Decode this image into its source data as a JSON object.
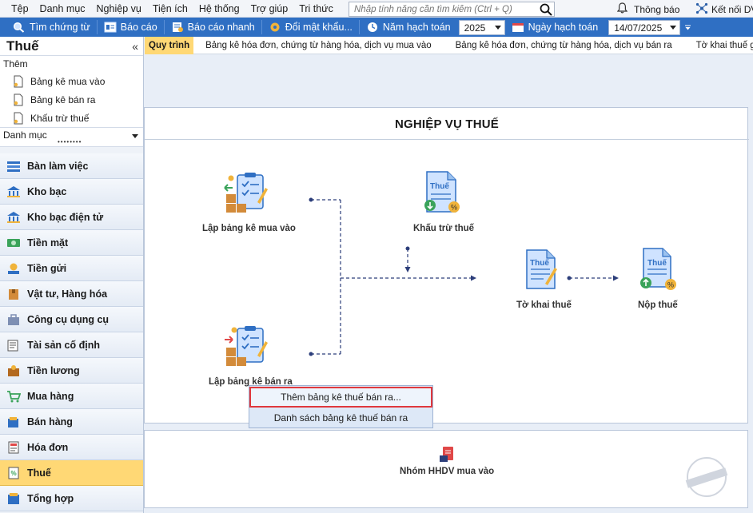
{
  "menubar": {
    "items": [
      "Tệp",
      "Danh mục",
      "Nghiệp vụ",
      "Tiện ích",
      "Hệ thống",
      "Trợ giúp",
      "Tri thức"
    ],
    "search_placeholder": "Nhập tính năng cần tìm kiếm (Ctrl + Q)",
    "notification_label": "Thông báo",
    "connect_label": "Kết nối DV"
  },
  "toolbar": {
    "find_label": "Tìm chứng từ",
    "report_label": "Báo cáo",
    "quick_report_label": "Báo cáo nhanh",
    "change_password_label": "Đổi mật khẩu...",
    "fiscal_year_label": "Năm hạch toán",
    "fiscal_year_value": "2025",
    "accounting_date_label": "Ngày hạch toán",
    "accounting_date_value": "14/07/2025"
  },
  "sidebar": {
    "title": "Thuế",
    "collapse_glyph": "«",
    "add_section_title": "Thêm",
    "add_links": [
      "Bảng kê mua vào",
      "Bảng kê bán ra",
      "Khấu trừ thuế"
    ],
    "category_label": "Danh mục",
    "nav_items": [
      {
        "label": "Bàn làm việc",
        "icon": "desk-icon"
      },
      {
        "label": "Kho bạc",
        "icon": "treasury-icon"
      },
      {
        "label": "Kho bạc điện tử",
        "icon": "e-treasury-icon"
      },
      {
        "label": "Tiền mặt",
        "icon": "cash-icon"
      },
      {
        "label": "Tiền gửi",
        "icon": "deposit-icon"
      },
      {
        "label": "Vật tư, Hàng hóa",
        "icon": "goods-icon"
      },
      {
        "label": "Công cụ dụng cụ",
        "icon": "tools-icon"
      },
      {
        "label": "Tài sản cố định",
        "icon": "fixed-assets-icon"
      },
      {
        "label": "Tiền lương",
        "icon": "salary-icon"
      },
      {
        "label": "Mua hàng",
        "icon": "cart-icon"
      },
      {
        "label": "Bán hàng",
        "icon": "sales-icon"
      },
      {
        "label": "Hóa đơn",
        "icon": "invoice-icon"
      },
      {
        "label": "Thuế",
        "icon": "tax-icon"
      },
      {
        "label": "Tổng hợp",
        "icon": "summary-icon"
      }
    ],
    "active_item": "Thuế"
  },
  "tabs": [
    "Quy trình",
    "Bảng kê hóa đơn, chứng từ hàng hóa, dịch vụ mua vào",
    "Bảng kê hóa đơn, chứng từ hàng hóa, dịch vụ bán ra",
    "Tờ khai thuế giá trị gia"
  ],
  "process": {
    "title": "NGHIỆP VỤ THUẾ",
    "purchase_list_label": "Lập bảng kê mua vào",
    "sales_list_label": "Lập bảng kê bán ra",
    "deduction_label": "Khấu trừ thuế",
    "declaration_label": "Tờ khai thuế",
    "payment_label": "Nộp thuế",
    "icon_text": "Thuế",
    "hhdv_group_label": "Nhóm HHDV mua vào"
  },
  "popup": {
    "items": [
      "Thêm bảng kê thuế bán ra...",
      "Danh sách bảng kê thuế bán ra"
    ]
  },
  "colors": {
    "toolbar_bg": "#2f6fc3",
    "active_bg": "#ffd875",
    "highlight_border": "#e0383d",
    "flow_line": "#2c3e7a"
  }
}
